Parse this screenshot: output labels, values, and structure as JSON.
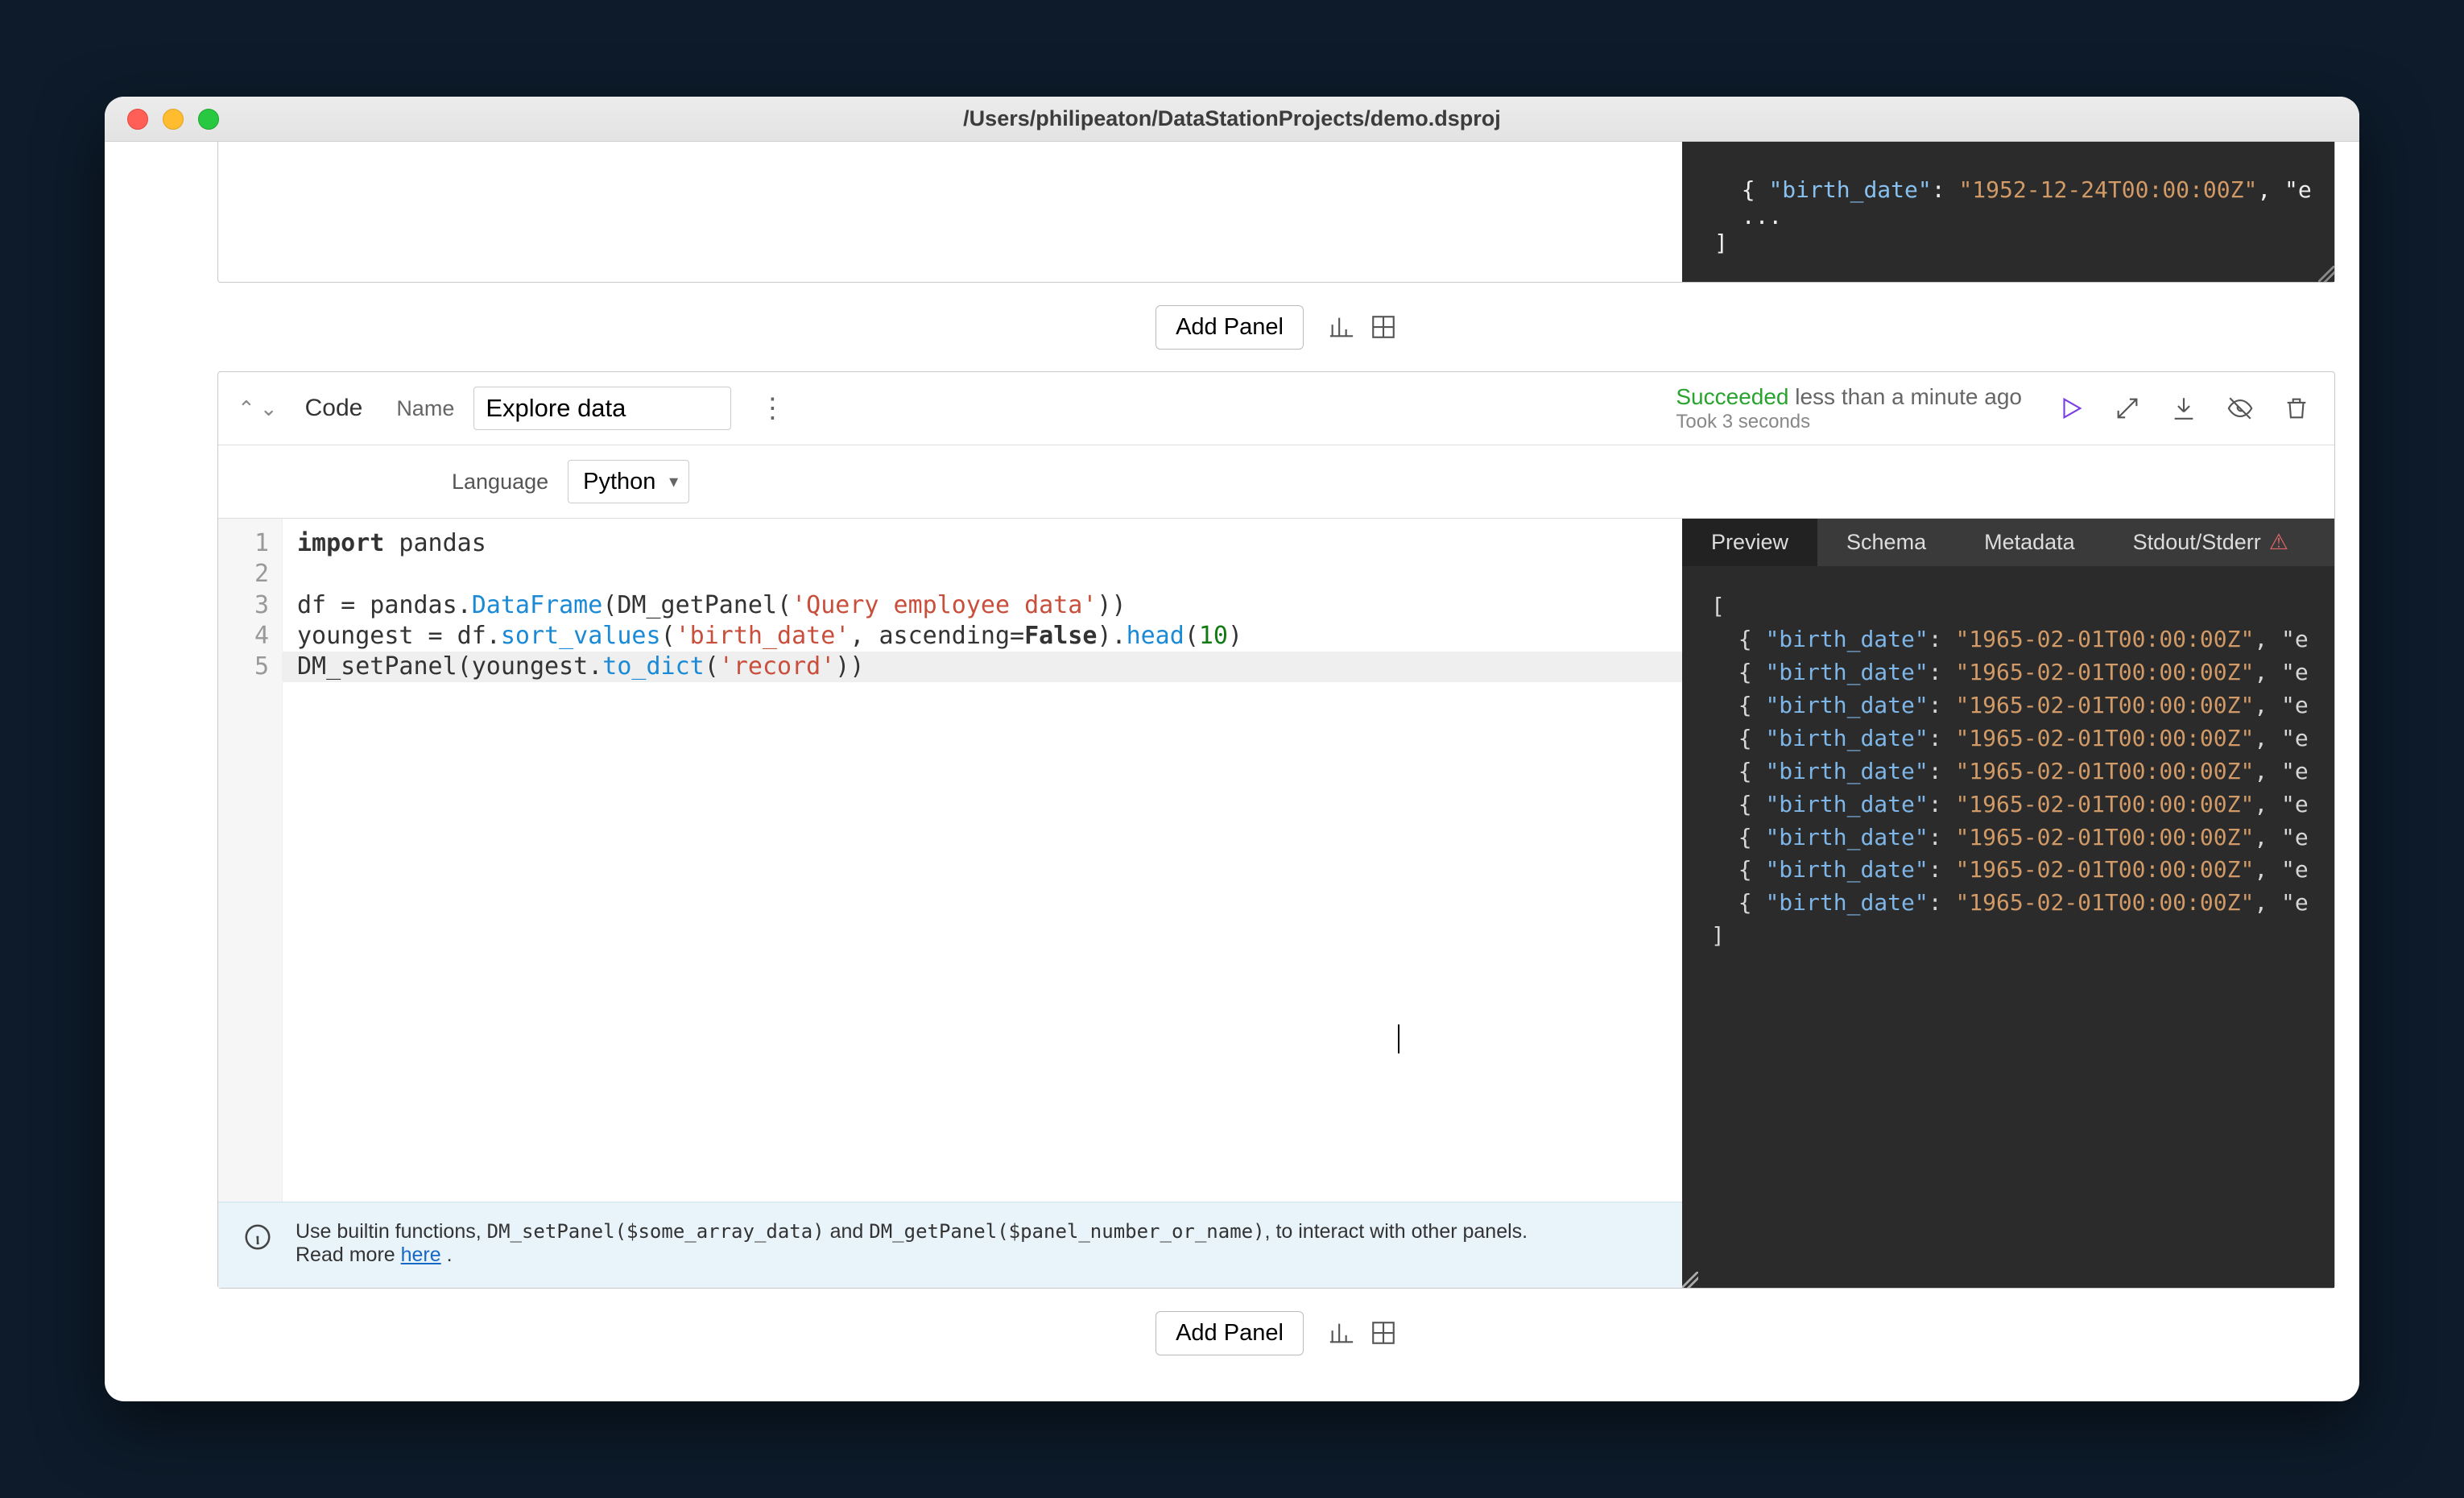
{
  "window": {
    "title": "/Users/philipeaton/DataStationProjects/demo.dsproj"
  },
  "prev_output": {
    "row": {
      "key": "\"birth_date\"",
      "val": "\"1952-12-24T00:00:00Z\"",
      "trail": ", \"e"
    },
    "dots": "...",
    "close": "]"
  },
  "add": {
    "label": "Add Panel"
  },
  "panel": {
    "type": "Code",
    "name_label": "Name",
    "name_value": "Explore data",
    "status_succ": "Succeeded",
    "status_rest": " less than a minute ago",
    "status_sub": "Took 3 seconds",
    "lang_label": "Language",
    "lang_value": "Python"
  },
  "code": {
    "l1a": "import",
    "l1b": " pandas",
    "l2": "",
    "l3a": "df = pandas.",
    "l3b": "DataFrame",
    "l3c": "(DM_getPanel(",
    "l3d": "'Query employee data'",
    "l3e": "))",
    "l4a": "youngest = df.",
    "l4b": "sort_values",
    "l4c": "(",
    "l4d": "'birth_date'",
    "l4e": ", ascending=",
    "l4f": "False",
    "l4g": ").",
    "l4h": "head",
    "l4i": "(",
    "l4j": "10",
    "l4k": ")",
    "l5a": "DM_setPanel(youngest.",
    "l5b": "to_dict",
    "l5c": "(",
    "l5d": "'record'",
    "l5e": "))"
  },
  "gutter": {
    "n1": "1",
    "n2": "2",
    "n3": "3",
    "n4": "4",
    "n5": "5"
  },
  "info": {
    "t1": "Use builtin functions, ",
    "c1": "DM_setPanel($some_array_data)",
    "t2": " and ",
    "c2": "DM_getPanel($panel_number_or_name)",
    "t3": ", to interact with other panels.",
    "t4": "Read more  ",
    "link": "here",
    "t5": " ."
  },
  "tabs": {
    "preview": "Preview",
    "schema": "Schema",
    "metadata": "Metadata",
    "stdout": "Stdout/Stderr"
  },
  "preview": {
    "open": "[",
    "row_prefix": "  { ",
    "key": "\"birth_date\"",
    "colon": ": ",
    "val": "\"1965-02-01T00:00:00Z\"",
    "trail": ", \"e",
    "close": "]"
  }
}
